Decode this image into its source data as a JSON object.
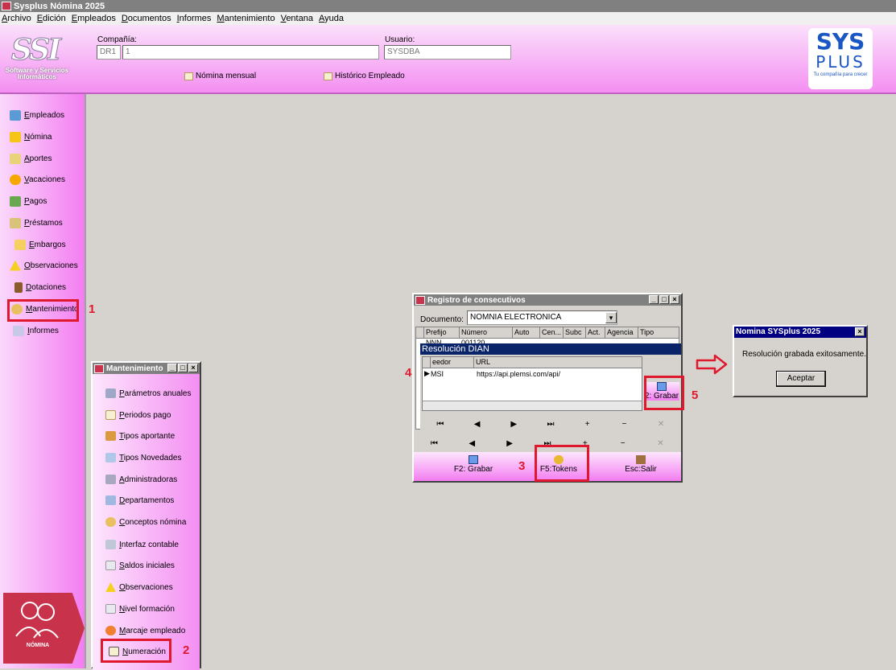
{
  "app": {
    "title": "Sysplus Nómina 2025"
  },
  "menu": [
    "Archivo",
    "Edición",
    "Empleados",
    "Documentos",
    "Informes",
    "Mantenimiento",
    "Ventana",
    "Ayuda"
  ],
  "header": {
    "ssi_logo": "SSI",
    "ssi_sub": "Software y Servicios Informáticos",
    "company_label": "Compañía:",
    "company_code": "DR1",
    "company_name": "1",
    "user_label": "Usuario:",
    "user_value": "SYSDBA",
    "link_nomina": "Nómina mensual",
    "link_historico": "Histórico Empleado",
    "sys_t1": "SYS",
    "sys_t2": "PLUS",
    "sys_t3": "Tu compañía para crecer"
  },
  "sidebar": {
    "items": [
      "Empleados",
      "Nómina",
      "Aportes",
      "Vacaciones",
      "Pagos",
      "Préstamos",
      "Embargos",
      "Observaciones",
      "Dotaciones",
      "Mantenimiento",
      "Informes"
    ],
    "badge": "NÓMINA"
  },
  "mant_window": {
    "title": "Mantenimiento",
    "items": [
      "Parámetros anuales",
      "Periodos pago",
      "Tipos aportante",
      "Tipos Novedades",
      "Administradoras",
      "Departamentos",
      "Conceptos nómina",
      "Interfaz contable",
      "Saldos iniciales",
      "Observaciones",
      "Nivel formación",
      "Marcaje empleado",
      "Numeración"
    ]
  },
  "registro": {
    "title": "Registro de consecutivos",
    "doc_label": "Documento:",
    "doc_value": "NOMNIA ELECTRONICA",
    "cols": [
      "Prefijo",
      "Número",
      "Auto",
      "Cen...",
      "Subc",
      "Act.",
      "Agencia",
      "Tipo"
    ],
    "row": {
      "prefix": "NNN",
      "number": "001120"
    },
    "grabar": "F2: Grabar",
    "tokens": "F5:Tokens",
    "salir": "Esc:Salir"
  },
  "dian": {
    "title": "Resolución DIAN",
    "cols": [
      "eedor",
      "URL"
    ],
    "row": {
      "prov": "MSI",
      "url": "https://api.plemsi.com/api/"
    },
    "grabar": "2: Grabar"
  },
  "message": {
    "title": "Nomina SYSplus 2025",
    "text": "Resolución grabada exitosamente.",
    "ok": "Aceptar"
  },
  "annotations": [
    "1",
    "2",
    "3",
    "4",
    "5"
  ],
  "nav_symbols": [
    "⏮",
    "◀",
    "▶",
    "⏭",
    "+",
    "−",
    "✕"
  ],
  "colors": {
    "accent_pink": "#f37df1",
    "annotation_red": "#e0182e",
    "dian_bar": "#0a246a"
  }
}
